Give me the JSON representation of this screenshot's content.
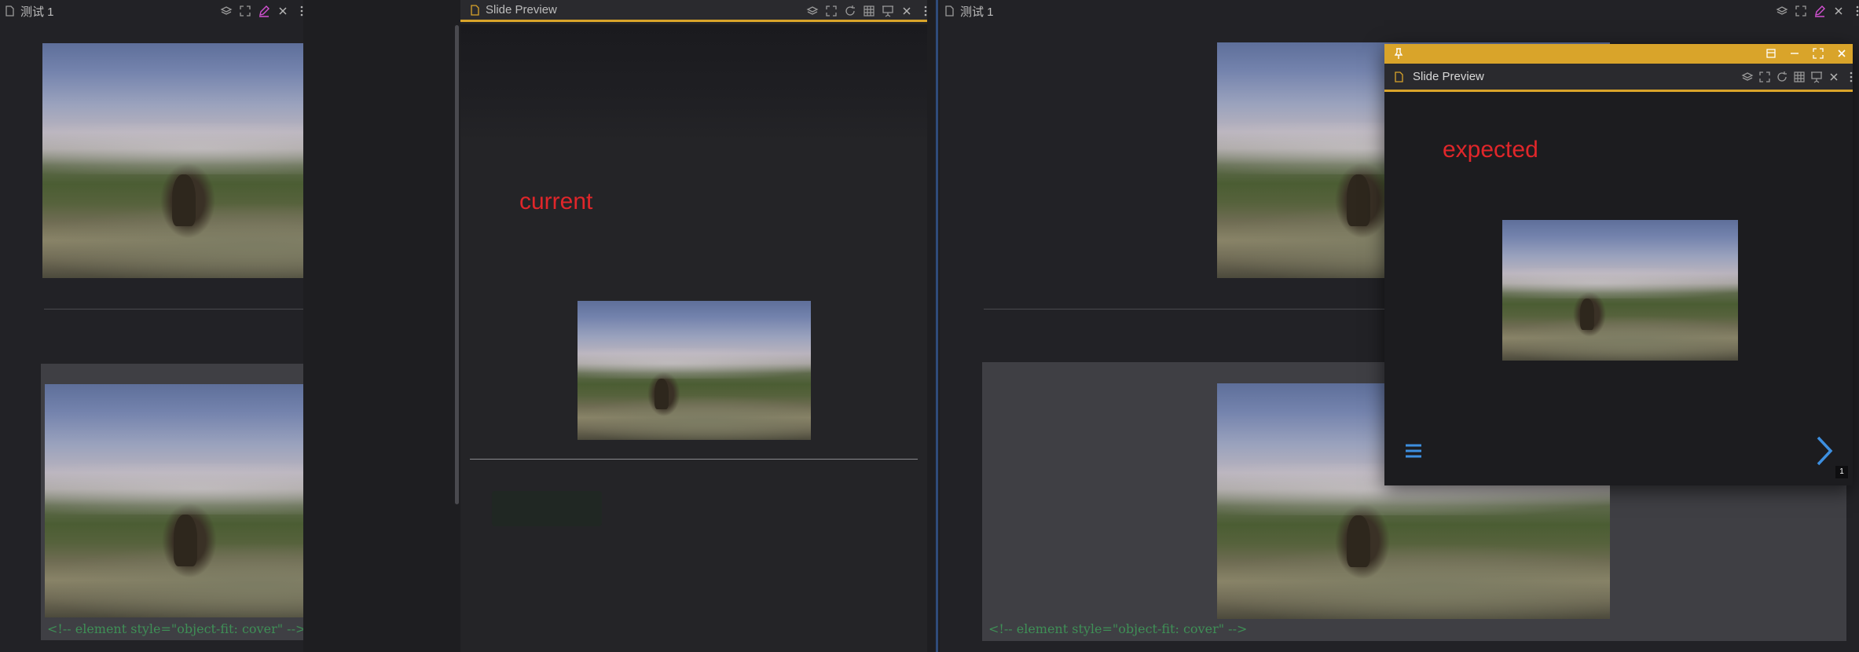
{
  "left_pane": {
    "tab_title": "测试 1",
    "code_comment": "<!-- element style=\"object-fit: cover\" -->"
  },
  "preview_pane": {
    "tab_title": "Slide Preview",
    "annotation": "current"
  },
  "right_pane": {
    "tab_title": "测试 1",
    "code_comment": "<!-- element style=\"object-fit: cover\" -->"
  },
  "floating_window": {
    "tab_title": "Slide Preview",
    "annotation": "expected",
    "slide_number": "1"
  },
  "colors": {
    "accent": "#d9a42a",
    "annotation": "#e0262a",
    "nav": "#3d8fe0",
    "comment": "#3f8f56"
  },
  "icons": [
    "file-icon",
    "layers-icon",
    "fullscreen-icon",
    "edit-icon",
    "close-icon",
    "more-icon",
    "reload-icon",
    "grid-icon",
    "presentation-icon",
    "pin-icon",
    "minimize-icon",
    "maximize-icon",
    "menu-icon",
    "chevron-right-icon"
  ]
}
